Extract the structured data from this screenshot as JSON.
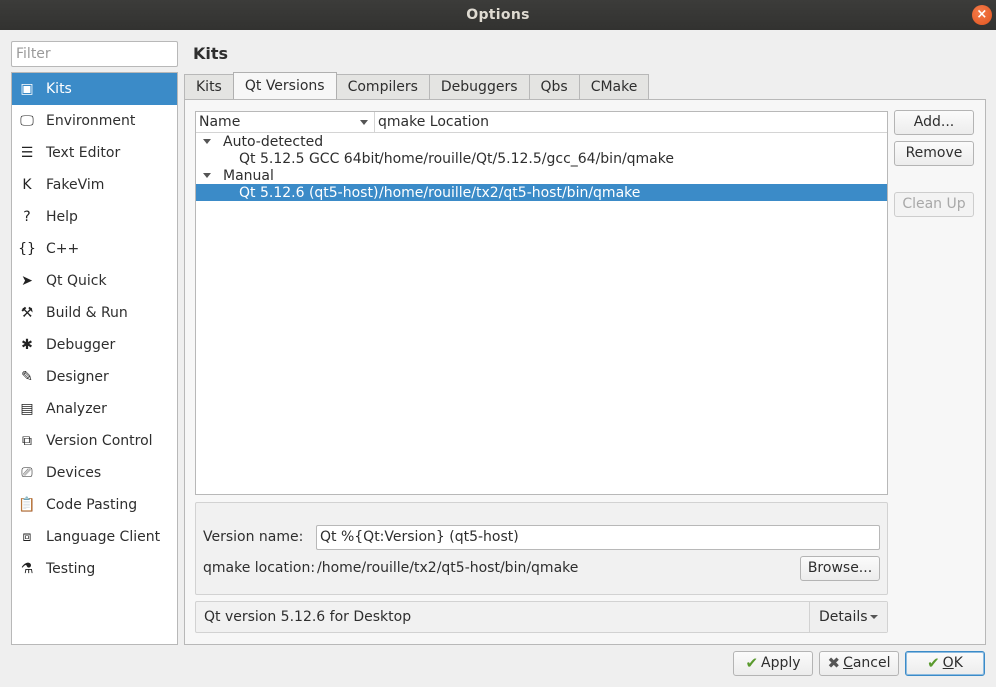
{
  "window": {
    "title": "Options",
    "close_glyph": "×"
  },
  "filter": {
    "placeholder": "Filter",
    "value": ""
  },
  "sidebar": {
    "items": [
      {
        "label": "Kits",
        "icon": "kits-icon",
        "glyph": "▣",
        "selected": true
      },
      {
        "label": "Environment",
        "icon": "monitor-icon",
        "glyph": "🖵"
      },
      {
        "label": "Text Editor",
        "icon": "text-editor-icon",
        "glyph": "☰"
      },
      {
        "label": "FakeVim",
        "icon": "fakevim-icon",
        "glyph": "K"
      },
      {
        "label": "Help",
        "icon": "help-icon",
        "glyph": "?"
      },
      {
        "label": "C++",
        "icon": "cpp-braces-icon",
        "glyph": "{}"
      },
      {
        "label": "Qt Quick",
        "icon": "qt-quick-icon",
        "glyph": "➤"
      },
      {
        "label": "Build & Run",
        "icon": "hammer-icon",
        "glyph": "⚒"
      },
      {
        "label": "Debugger",
        "icon": "bug-icon",
        "glyph": "✱"
      },
      {
        "label": "Designer",
        "icon": "pencil-icon",
        "glyph": "✎"
      },
      {
        "label": "Analyzer",
        "icon": "analyzer-icon",
        "glyph": "▤"
      },
      {
        "label": "Version Control",
        "icon": "version-control-icon",
        "glyph": "⧉"
      },
      {
        "label": "Devices",
        "icon": "devices-icon",
        "glyph": "⎚"
      },
      {
        "label": "Code Pasting",
        "icon": "clipboard-icon",
        "glyph": "📋"
      },
      {
        "label": "Language Client",
        "icon": "language-client-icon",
        "glyph": "⧈"
      },
      {
        "label": "Testing",
        "icon": "flask-icon",
        "glyph": "⚗"
      }
    ]
  },
  "page": {
    "title": "Kits"
  },
  "tabs": [
    {
      "label": "Kits"
    },
    {
      "label": "Qt Versions",
      "active": true
    },
    {
      "label": "Compilers"
    },
    {
      "label": "Debuggers"
    },
    {
      "label": "Qbs"
    },
    {
      "label": "CMake"
    }
  ],
  "tree": {
    "columns": {
      "name": "Name",
      "location": "qmake Location"
    },
    "groups": [
      {
        "label": "Auto-detected",
        "children": [
          {
            "name": "Qt 5.12.5 GCC 64bit",
            "location": "/home/rouille/Qt/5.12.5/gcc_64/bin/qmake"
          }
        ]
      },
      {
        "label": "Manual",
        "children": [
          {
            "name": "Qt 5.12.6 (qt5-host)",
            "location": "/home/rouille/tx2/qt5-host/bin/qmake",
            "selected": true
          }
        ]
      }
    ]
  },
  "actions": {
    "add": "Add...",
    "remove": "Remove",
    "cleanup": "Clean Up"
  },
  "details": {
    "version_name_label": "Version name:",
    "version_name_value": "Qt %{Qt:Version} (qt5-host)",
    "qmake_location_label": "qmake location:",
    "qmake_location_value": "/home/rouille/tx2/qt5-host/bin/qmake",
    "browse": "Browse..."
  },
  "summary": {
    "text": "Qt version 5.12.6 for Desktop",
    "details_button": "Details"
  },
  "footer": {
    "apply": {
      "label": "Apply",
      "icon": "checkmark-icon"
    },
    "cancel": {
      "label_prefix": "",
      "mnemonic": "C",
      "label_rest": "ancel",
      "icon": "cross-icon"
    },
    "ok": {
      "mnemonic": "O",
      "label_rest": "K",
      "icon": "checkmark-icon"
    }
  }
}
